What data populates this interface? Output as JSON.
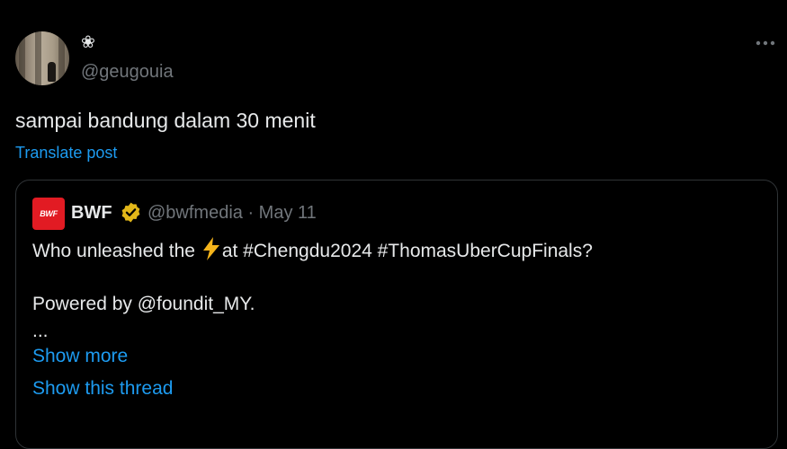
{
  "author": {
    "display_name": "❀",
    "handle": "@geugouia"
  },
  "tweet": {
    "text": "sampai bandung dalam 30 menit",
    "translate_label": "Translate post"
  },
  "quoted": {
    "avatar_text": "BWF",
    "name": "BWF",
    "handle_date": "@bwfmedia · May 11",
    "line1_before": "Who unleashed the",
    "line1_after": "at #Chengdu2024 #ThomasUberCupFinals?",
    "line2": "",
    "line3": "Powered by @foundit_MY.",
    "line4": "...",
    "show_more": "Show more",
    "show_thread": "Show this thread"
  },
  "colors": {
    "background": "#000000",
    "text": "#e7e9ea",
    "muted": "#71767b",
    "link": "#1d9bf0",
    "border": "#2f3336",
    "verified_gold": "#e2b719",
    "bwf_red": "#e21b23"
  },
  "icons": {
    "more": "more-dots-icon",
    "verified": "verified-badge-icon",
    "bolt": "lightning-bolt-icon"
  }
}
